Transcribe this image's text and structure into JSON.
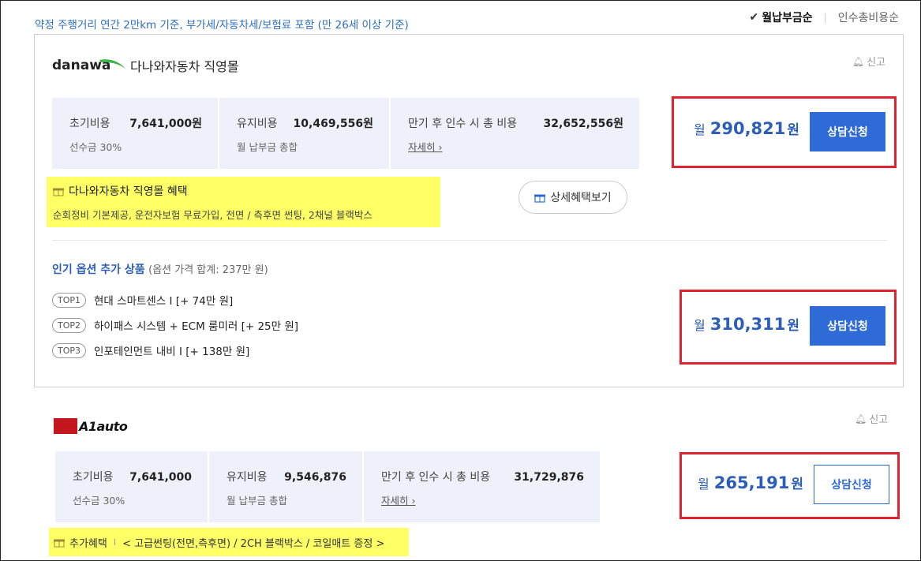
{
  "notice": "약정 주행거리 연간 2만km 기준, 부가세/자동차세/보험료 포함 (만 26세 이상 기준)",
  "sort": {
    "active_check": "✔",
    "active": "월납부금순",
    "inactive": "인수총비용순"
  },
  "dealer1": {
    "logo_text": "danawa",
    "name": "다나와자동차 직영몰",
    "report": "신고",
    "costs": {
      "initial_label": "초기비용",
      "initial_value": "7,641,000원",
      "initial_sub": "선수금 30%",
      "maint_label": "유지비용",
      "maint_value": "10,469,556원",
      "maint_sub": "월 납부금 총합",
      "total_label": "만기 후 인수 시 총 비용",
      "total_value": "32,652,556원",
      "total_link": "자세히 ›"
    },
    "price_prefix": "월",
    "price": "290,821",
    "price_unit": "원",
    "consult": "상담신청",
    "benefit_title": "다나와자동차 직영몰 혜택",
    "benefit_desc": "순회정비 기본제공, 운전자보험 무료가입, 전면 / 측후면 썬팅, 2채널 블랙박스",
    "detail_button": "상세혜택보기",
    "options": {
      "title_strong": "인기 옵션 추가 상품",
      "title_light": "(옵션 가격 합계: 237만 원)",
      "items": [
        {
          "badge": "TOP1",
          "text": "현대 스마트센스 I  [+ 74만 원]"
        },
        {
          "badge": "TOP2",
          "text": "하이패스 시스템 + ECM 룸미러 [+ 25만 원]"
        },
        {
          "badge": "TOP3",
          "text": "인포테인먼트 내비 I [+ 138만 원]"
        }
      ],
      "price_prefix": "월",
      "price": "310,311",
      "price_unit": "원",
      "consult": "상담신청"
    }
  },
  "dealer2": {
    "logo_text": "A1auto",
    "report": "신고",
    "costs": {
      "initial_label": "초기비용",
      "initial_value": "7,641,000",
      "initial_sub": "선수금 30%",
      "maint_label": "유지비용",
      "maint_value": "9,546,876",
      "maint_sub": "월 납부금 총합",
      "total_label": "만기 후 인수 시 총 비용",
      "total_value": "31,729,876",
      "total_link": "자세히 ›"
    },
    "price_prefix": "월",
    "price": "265,191",
    "price_unit": "원",
    "consult": "상담신청",
    "benefit_label": "추가혜택",
    "benefit_sep": "I",
    "benefit_desc": "< 고급썬팅(전면,측후면) / 2CH 블랙박스 / 코일매트 증정 >"
  },
  "colors": {
    "accent_blue": "#2e6bd6",
    "price_blue": "#2c5eb8",
    "highlight_yellow": "#ffff66",
    "annotation_red": "#e02330"
  }
}
